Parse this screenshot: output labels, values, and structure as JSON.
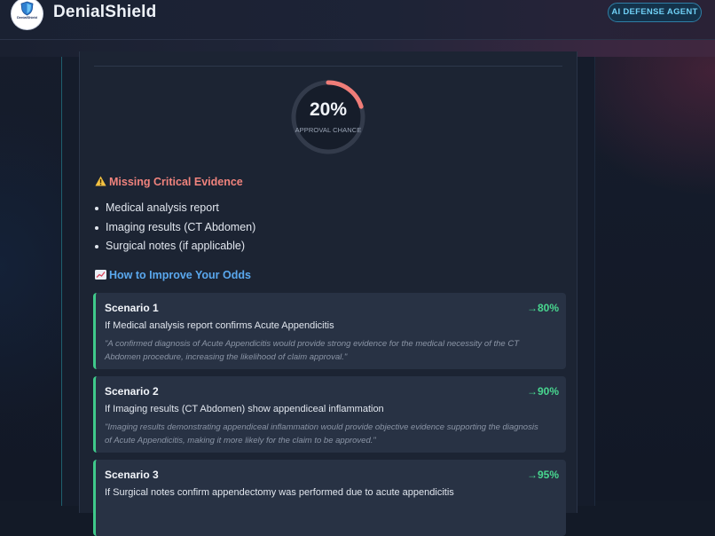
{
  "app": {
    "brand": "DenialShield",
    "logo_text": "DenialShield",
    "badge": "AI DEFENSE AGENT"
  },
  "gauge": {
    "value": "20%",
    "fraction": 0.2,
    "label": "APPROVAL CHANCE",
    "colors": {
      "track": "#333b4b",
      "fill": "#f07d78"
    }
  },
  "missing": {
    "heading": "Missing Critical Evidence",
    "icon": "warning-icon",
    "items": [
      "Medical analysis report",
      "Imaging results (CT Abdomen)",
      "Surgical notes (if applicable)"
    ]
  },
  "improve": {
    "heading": "How to Improve Your Odds",
    "icon": "chart-up-icon"
  },
  "scenarios": [
    {
      "title": "Scenario 1",
      "odds": "→80%",
      "condition": "If Medical analysis report confirms Acute Appendicitis",
      "quote_line1": "\"A confirmed diagnosis of Acute Appendicitis would provide strong evidence for the medical necessity of the CT",
      "quote_line2": "Abdomen procedure, increasing the likelihood of claim approval.\""
    },
    {
      "title": "Scenario 2",
      "odds": "→90%",
      "condition": "If Imaging results (CT Abdomen) show appendiceal inflammation",
      "quote_line1": "\"Imaging results demonstrating appendiceal inflammation would provide objective evidence supporting the diagnosis",
      "quote_line2": "of Acute Appendicitis, making it more likely for the claim to be approved.\""
    },
    {
      "title": "Scenario 3",
      "odds": "→95%",
      "condition": "If Surgical notes confirm appendectomy was performed due to acute appendicitis",
      "quote_line1": "",
      "quote_line2": ""
    }
  ],
  "colors": {
    "accent_green": "#48d68f",
    "accent_red": "#f0837d",
    "accent_blue": "#5aa8ee",
    "badge_text": "#6fd0f5"
  }
}
